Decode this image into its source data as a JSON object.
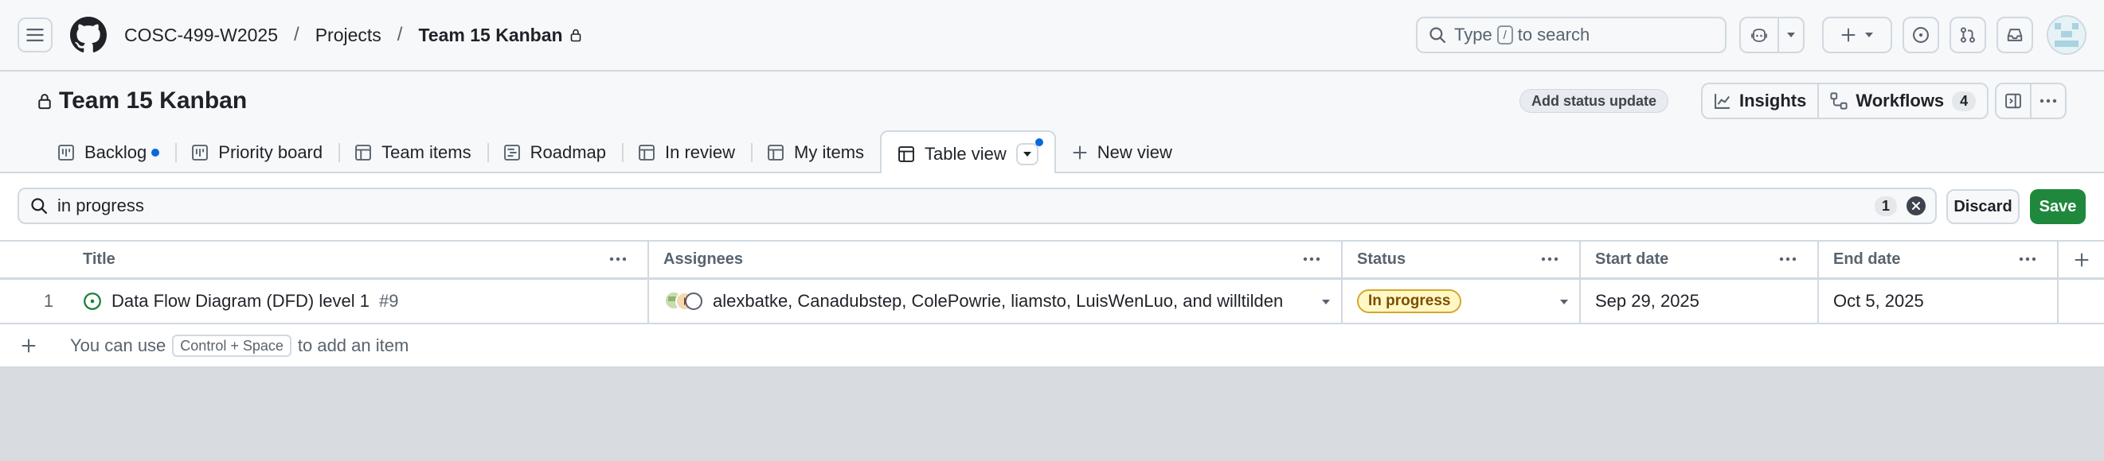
{
  "breadcrumb": {
    "org": "COSC-499-W2025",
    "projects": "Projects",
    "current": "Team 15 Kanban",
    "separator": "/"
  },
  "search": {
    "prefix": "Type",
    "key": "/",
    "suffix": "to search"
  },
  "project": {
    "title": "Team 15 Kanban",
    "status_update_label": "Add status update",
    "insights_label": "Insights",
    "workflows_label": "Workflows",
    "workflows_count": "4"
  },
  "tabs": [
    {
      "label": "Backlog",
      "icon": "board-icon",
      "unsaved_dot": true
    },
    {
      "label": "Priority board",
      "icon": "board-icon"
    },
    {
      "label": "Team items",
      "icon": "table-icon"
    },
    {
      "label": "Roadmap",
      "icon": "roadmap-icon"
    },
    {
      "label": "In review",
      "icon": "table-icon"
    },
    {
      "label": "My items",
      "icon": "table-icon"
    },
    {
      "label": "Table view",
      "icon": "table-icon",
      "active": true,
      "unsaved_dot": true
    }
  ],
  "new_view_label": "New view",
  "filter": {
    "query": "in progress",
    "count": "1",
    "discard_label": "Discard",
    "save_label": "Save"
  },
  "columns": [
    "Title",
    "Assignees",
    "Status",
    "Start date",
    "End date"
  ],
  "rows": [
    {
      "num": "1",
      "title": "Data Flow Diagram (DFD) level 1",
      "issue": "#9",
      "assignees": "alexbatke, Canadubstep, ColePowrie, liamsto, LuisWenLuo, and willtilden",
      "status": "In progress",
      "start": "Sep 29, 2025",
      "end": "Oct 5, 2025"
    }
  ],
  "add_item": {
    "prefix": "You can use",
    "shortcut": "Control + Space",
    "suffix": "to add an item"
  },
  "colors": {
    "accent_blue": "#0969da",
    "save_green": "#1f883d",
    "status_bg": "#fff8c5",
    "status_border": "#d4a72c",
    "open_issue_green": "#1a7f37"
  }
}
